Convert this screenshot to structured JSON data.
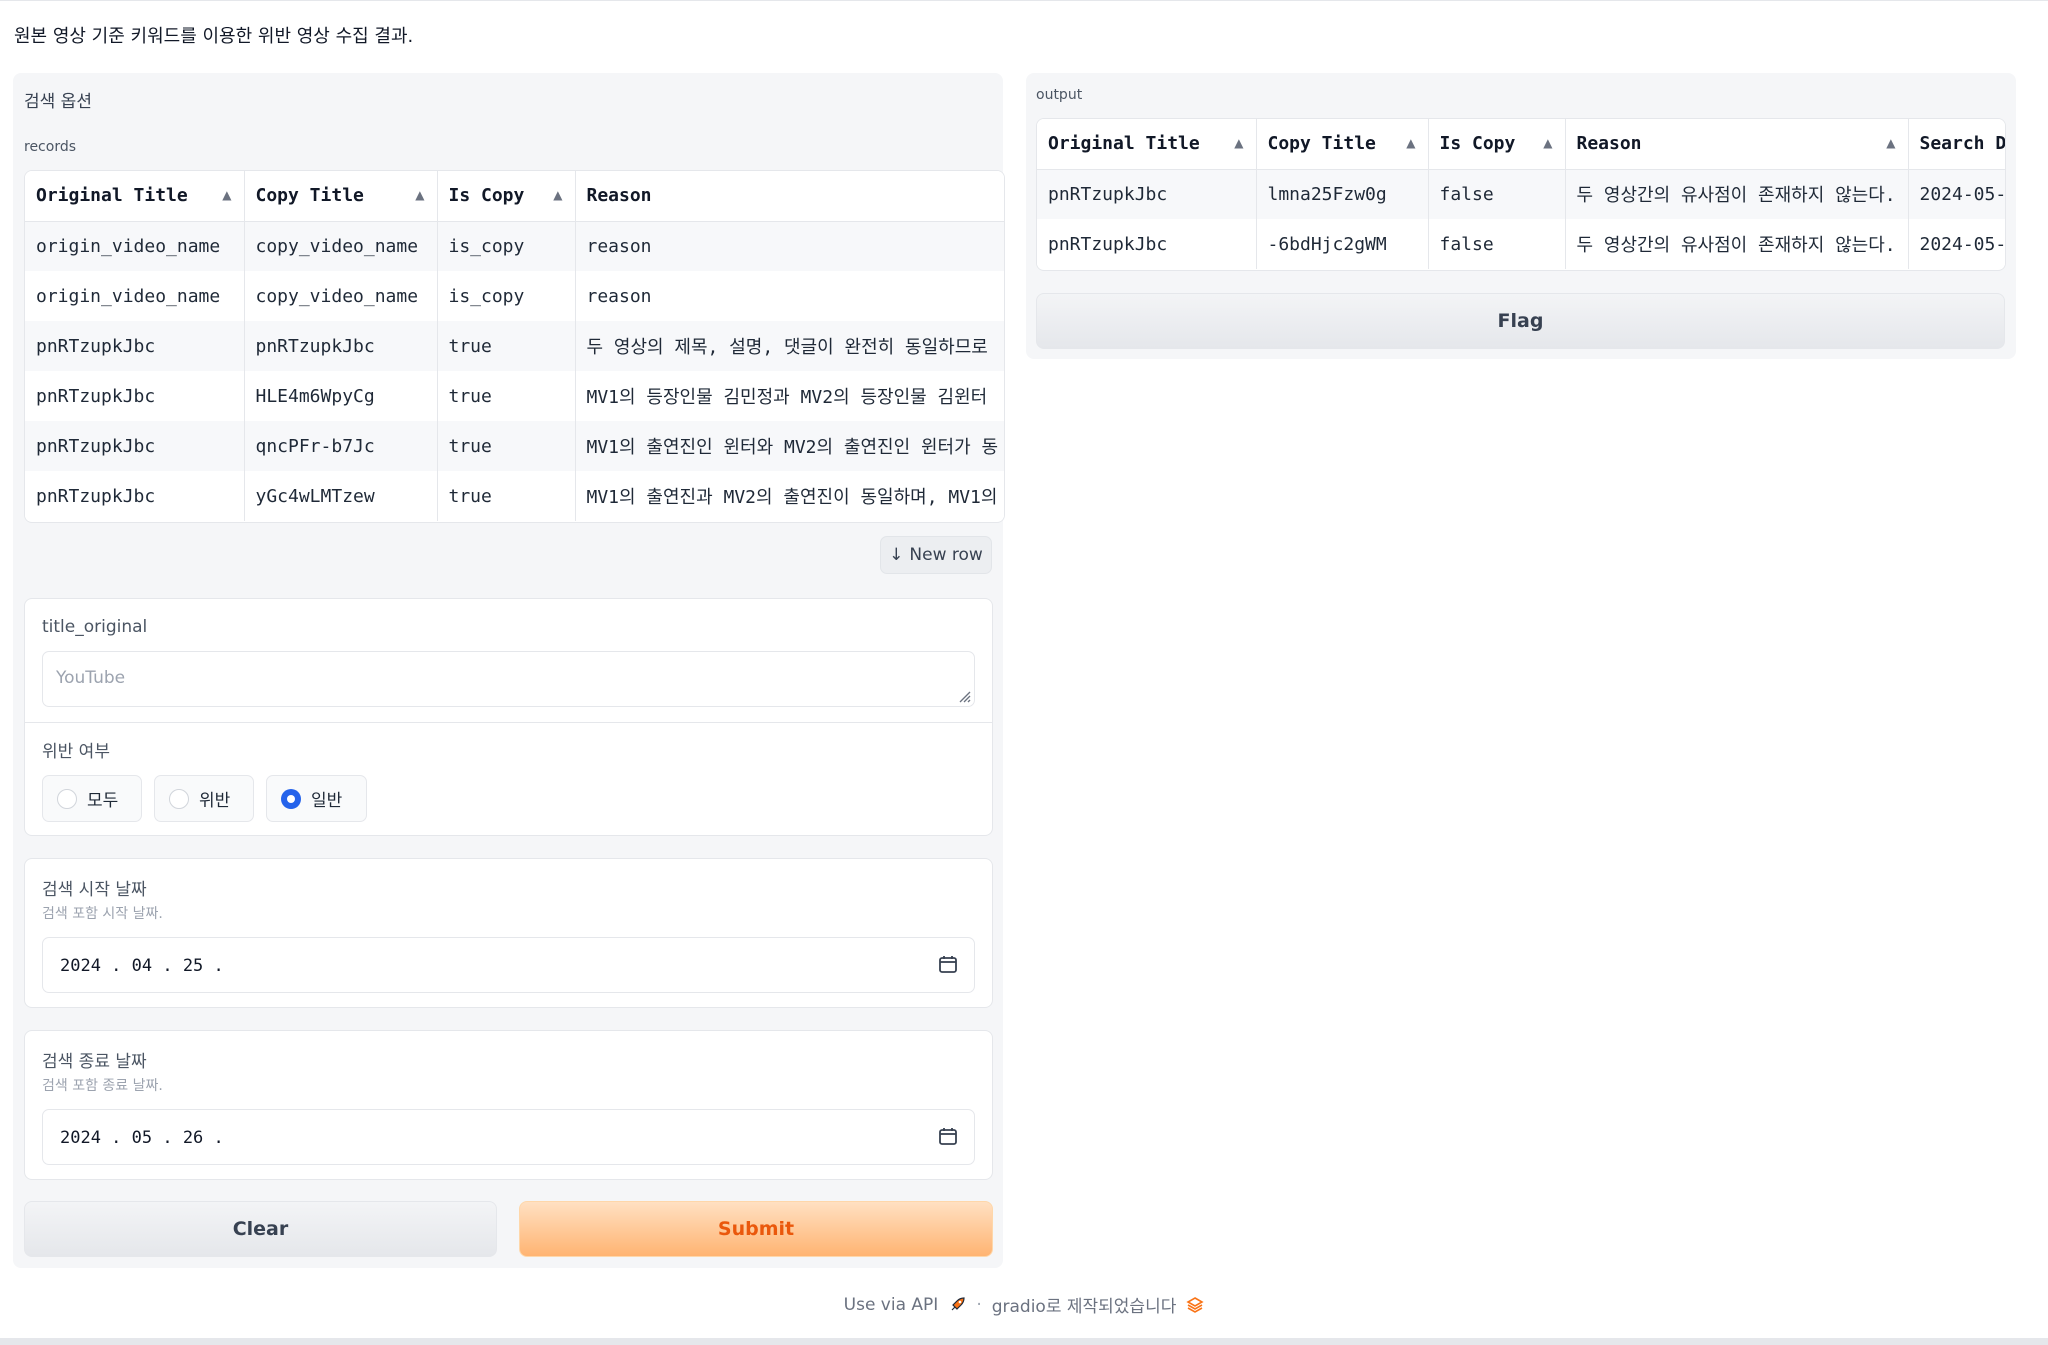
{
  "description": "원본 영상 기준 키워드를 이용한 위반 영상 수집 결과.",
  "left": {
    "section_title": "검색 옵션",
    "records_label": "records",
    "records_table": {
      "headers": [
        "Original Title",
        "Copy Title",
        "Is Copy",
        "Reason"
      ],
      "rows": [
        [
          "origin_video_name",
          "copy_video_name",
          "is_copy",
          "reason"
        ],
        [
          "origin_video_name",
          "copy_video_name",
          "is_copy",
          "reason"
        ],
        [
          "pnRTzupkJbc",
          "pnRTzupkJbc",
          "true",
          "두 영상의 제목, 설명, 댓글이 완전히 동일하므로"
        ],
        [
          "pnRTzupkJbc",
          "HLE4m6WpyCg",
          "true",
          "MV1의 등장인물 김민정과 MV2의 등장인물 김윈터"
        ],
        [
          "pnRTzupkJbc",
          "qncPFr-b7Jc",
          "true",
          "MV1의 출연진인 윈터와 MV2의 출연진인 윈터가 동"
        ],
        [
          "pnRTzupkJbc",
          "yGc4wLMTzew",
          "true",
          "MV1의 출연진과 MV2의 출연진이 동일하며, MV1의"
        ]
      ]
    },
    "new_row_label": "New row",
    "title_original": {
      "label": "title_original",
      "placeholder": "YouTube"
    },
    "violation": {
      "label": "위반 여부",
      "options": [
        "모두",
        "위반",
        "일반"
      ],
      "selected": "일반"
    },
    "start_date": {
      "label": "검색 시작 날짜",
      "info": "검색 포함 시작 날짜.",
      "value": "2024 . 04 . 25 ."
    },
    "end_date": {
      "label": "검색 종료 날짜",
      "info": "검색 포함 종료 날짜.",
      "value": "2024 . 05 . 26 ."
    },
    "clear_label": "Clear",
    "submit_label": "Submit"
  },
  "right": {
    "output_label": "output",
    "output_table": {
      "headers": [
        "Original Title",
        "Copy Title",
        "Is Copy",
        "Reason",
        "Search D"
      ],
      "rows": [
        [
          "pnRTzupkJbc",
          "lmna25Fzw0g",
          "false",
          "두 영상간의 유사점이 존재하지 않는다.",
          "2024-05-"
        ],
        [
          "pnRTzupkJbc",
          "-6bdHjc2gWM",
          "false",
          "두 영상간의 유사점이 존재하지 않는다.",
          "2024-05-"
        ]
      ]
    },
    "flag_label": "Flag"
  },
  "footer": {
    "api_label": "Use via API",
    "built_with": "gradio로 제작되었습니다"
  },
  "colors": {
    "accent": "#2563eb",
    "submit_text": "#ea580c",
    "submit_bg": "#ffb472"
  }
}
